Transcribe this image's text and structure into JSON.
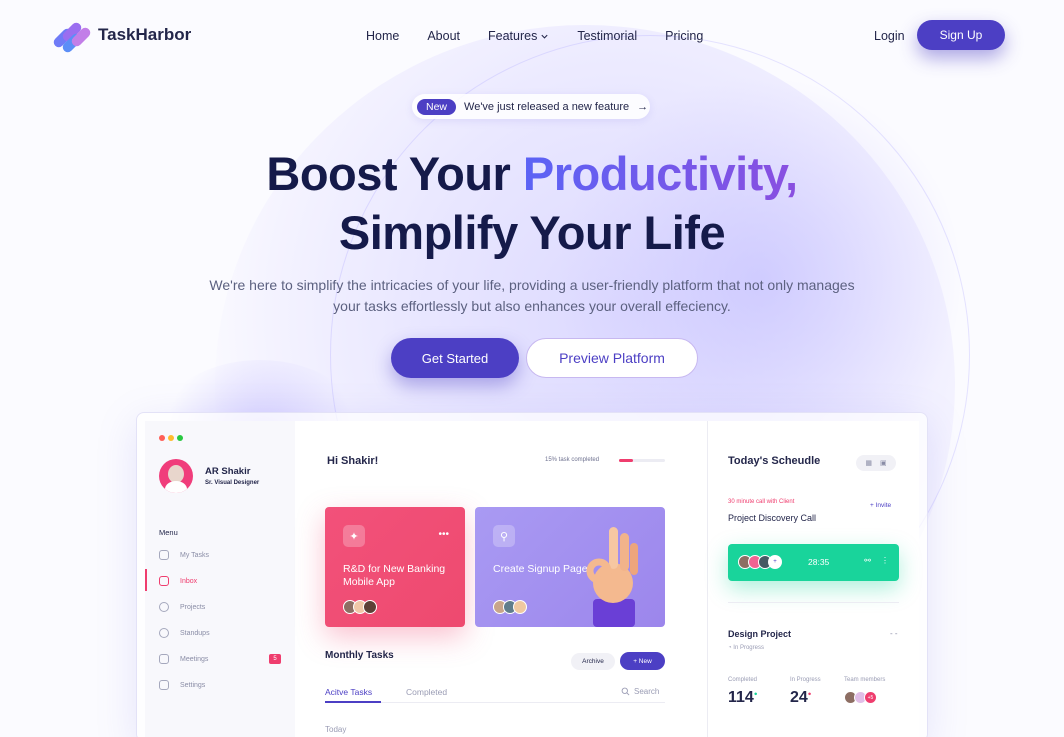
{
  "nav": {
    "brand": "TaskHarbor",
    "items": [
      {
        "label": "Home"
      },
      {
        "label": "About"
      },
      {
        "label": "Features"
      },
      {
        "label": "Testimorial"
      },
      {
        "label": "Pricing"
      }
    ],
    "features_chevron_icon": "chevron-down-icon",
    "login_label": "Login",
    "signup_label": "Sign Up"
  },
  "announcement": {
    "badge": "New",
    "text": "We've just released a new feature",
    "arrow": "→"
  },
  "hero": {
    "title_part1": "Boost Your ",
    "title_highlight": "Productivity,",
    "title_line2": "Simplify Your Life",
    "subtitle_line1": "We're here to simplify the intricacies of your life, providing a user-friendly platform that not only manages",
    "subtitle_line2": "your tasks effortlessly but also enhances your overall effeciency.",
    "cta_primary": "Get Started",
    "cta_secondary": "Preview Platform"
  },
  "dashboard": {
    "profile": {
      "name": "AR Shakir",
      "role": "Sr. Visual Designer"
    },
    "menu_label": "Menu",
    "sidebar_items": [
      {
        "label": "My Tasks",
        "icon": "inbox-icon"
      },
      {
        "label": "Inbox",
        "icon": "chat-icon",
        "active": true
      },
      {
        "label": "Projects",
        "icon": "compass-icon"
      },
      {
        "label": "Standups",
        "icon": "clock-icon"
      },
      {
        "label": "Meetings",
        "icon": "calendar-icon",
        "badge": "5"
      },
      {
        "label": "Settings",
        "icon": "sliders-icon"
      }
    ],
    "greeting": "Hi Shakir!",
    "progress_label": "15% task completed",
    "progress_value": 0.15,
    "cards": [
      {
        "title": "R&D for New Banking Mobile App",
        "icon": "bulb-icon",
        "more": "•••"
      },
      {
        "title": "Create Signup Page",
        "icon": "key-icon"
      }
    ],
    "monthly_tasks": "Monthly Tasks",
    "archive_label": "Archive",
    "new_label": "+ New",
    "tabs": [
      {
        "label": "Acitve Tasks",
        "active": true
      },
      {
        "label": "Completed"
      }
    ],
    "search_placeholder": "Search",
    "today_label": "Today",
    "schedule": {
      "title": "Today's Scheudle",
      "call_label": "30 minute call with Client",
      "invite": "+ Invite",
      "call_title": "Project Discovery Call",
      "call_time": "28:35",
      "call_extra": "+",
      "project_title": "Design Project",
      "project_more": "- -",
      "project_status": "In Progress",
      "stats": [
        {
          "label": "Completed",
          "value": "114"
        },
        {
          "label": "In Progress",
          "value": "24"
        },
        {
          "label": "Team members"
        }
      ],
      "team_extra": "+5"
    }
  },
  "colors": {
    "primary": "#4c3fc4",
    "accent_pink": "#ef3d6e",
    "accent_green": "#19d49b",
    "card_purple": "#a99af3"
  }
}
